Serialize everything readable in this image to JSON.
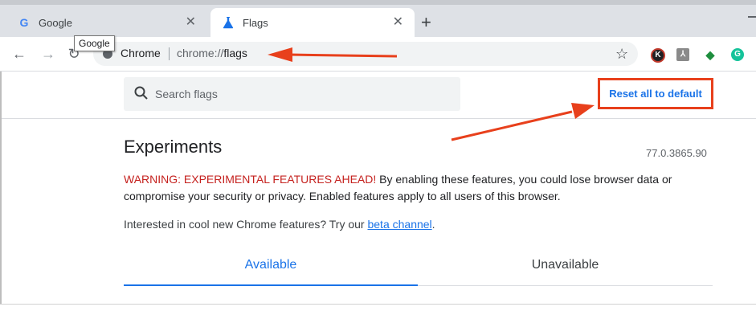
{
  "tabs": [
    {
      "title": "Google",
      "icon": "google-g-icon"
    },
    {
      "title": "Flags",
      "icon": "flask-icon"
    }
  ],
  "tooltip": "Google",
  "omnibox": {
    "site_label": "Chrome",
    "url_scheme": "chrome://",
    "url_path": "flags"
  },
  "search": {
    "placeholder": "Search flags"
  },
  "reset_button": "Reset all to default",
  "content": {
    "title": "Experiments",
    "version": "77.0.3865.90",
    "warning_prefix": "WARNING: EXPERIMENTAL FEATURES AHEAD!",
    "warning_body": " By enabling these features, you could lose browser data or compromise your security or privacy. Enabled features apply to all users of this browser.",
    "interest_text": "Interested in cool new Chrome features? Try our ",
    "interest_link": "beta channel",
    "interest_end": "."
  },
  "feature_tabs": {
    "available": "Available",
    "unavailable": "Unavailable"
  },
  "colors": {
    "accent": "#1a73e8",
    "warning": "#c5221f",
    "annotation": "#e8401c"
  }
}
